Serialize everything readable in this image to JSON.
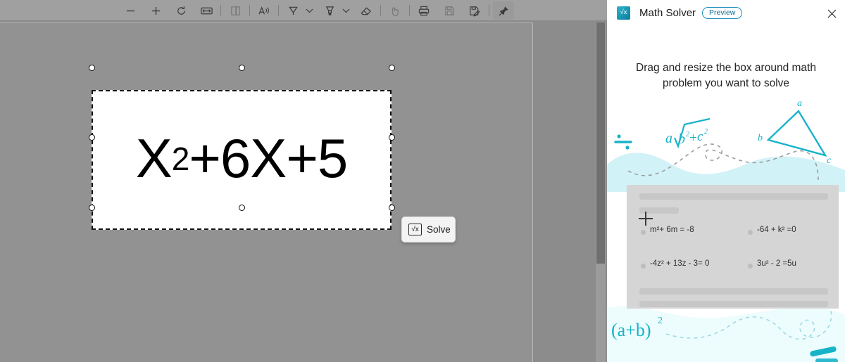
{
  "viewer": {
    "toolbar": {
      "items": [
        {
          "name": "zoom-out-icon",
          "label": "Zoom out",
          "state": "enabled"
        },
        {
          "name": "zoom-in-icon",
          "label": "Zoom in",
          "state": "enabled"
        },
        {
          "name": "rotate-icon",
          "label": "Rotate",
          "state": "enabled"
        },
        {
          "name": "fit-to-width-icon",
          "label": "Fit to width",
          "state": "enabled"
        },
        {
          "name": "page-view-icon",
          "label": "Page view",
          "state": "dim"
        },
        {
          "name": "read-aloud-icon",
          "label": "Read aloud",
          "state": "enabled"
        },
        {
          "name": "draw-pen-icon",
          "label": "Draw",
          "state": "enabled"
        },
        {
          "name": "draw-options-caret-icon",
          "label": "Draw options",
          "state": "enabled"
        },
        {
          "name": "highlight-icon",
          "label": "Highlight",
          "state": "enabled"
        },
        {
          "name": "highlight-options-caret-icon",
          "label": "Highlight options",
          "state": "enabled"
        },
        {
          "name": "erase-icon",
          "label": "Erase",
          "state": "enabled"
        },
        {
          "name": "text-select-icon",
          "label": "Text selection",
          "state": "dim"
        },
        {
          "name": "print-icon",
          "label": "Print",
          "state": "enabled"
        },
        {
          "name": "save-icon",
          "label": "Save",
          "state": "dim"
        },
        {
          "name": "save-as-icon",
          "label": "Save as",
          "state": "enabled"
        },
        {
          "name": "pin-icon",
          "label": "Pin toolbar",
          "state": "pinned"
        }
      ]
    },
    "document": {
      "equation_base": "X",
      "equation_exponent": "2",
      "equation_rest": "+6X+5"
    },
    "solve_button": {
      "label": "Solve",
      "icon": "√x"
    },
    "scrollbar": {
      "name": "vertical-scrollbar"
    }
  },
  "panel": {
    "icon_glyph": "√x",
    "title": "Math Solver",
    "badge": "Preview",
    "close_label": "✕",
    "instruction": "Drag and resize the box around math problem you want to solve",
    "illustration": {
      "accent_color": "#17b3c9",
      "blob_color": "#c9f0f6",
      "card_color": "#d5d5d5",
      "decor_top": {
        "division_sign": "÷",
        "radical_expression": "a√b²+c²",
        "triangle_labels": [
          "a",
          "b",
          "c"
        ]
      },
      "decor_bottom": {
        "binomial_expression": "(a+b)²"
      },
      "equations": [
        {
          "text": "m²+ 6m = -8"
        },
        {
          "text": "-64 + k² =0"
        },
        {
          "text": "-4z² + 13z - 3= 0"
        },
        {
          "text": "3u² - 2  =5u"
        }
      ]
    }
  }
}
